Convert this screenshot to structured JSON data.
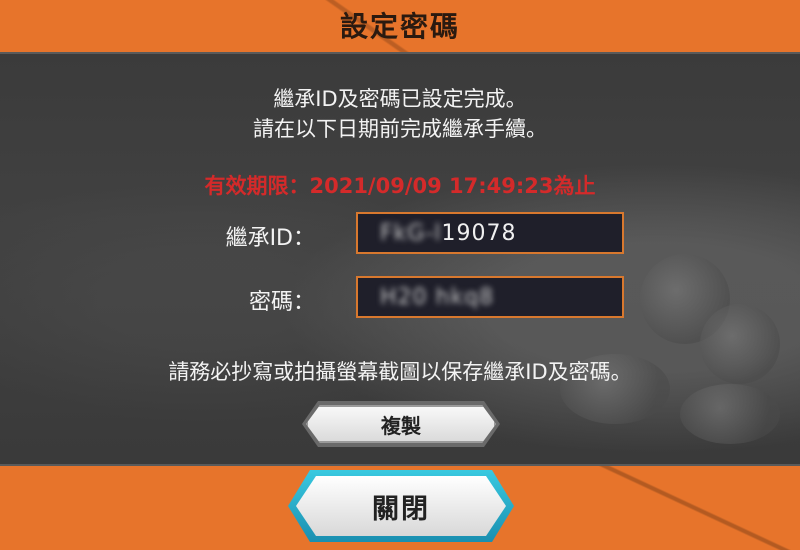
{
  "dialog": {
    "title": "設定密碼",
    "message_line1": "繼承ID及密碼已設定完成。",
    "message_line2": "請在以下日期前完成繼承手續。",
    "expiry": "有效期限：2021/09/09 17:49:23為止",
    "id_label": "繼承ID：",
    "id_value_visible": "19078",
    "id_value_blurred": "FkG‑l",
    "password_label": "密碼：",
    "password_value_blurred": "H20  hkq8",
    "note": "請務必抄寫或拍攝螢幕截圖以保存繼承ID及密碼。",
    "copy_button": "複製",
    "close_button": "關閉"
  },
  "colors": {
    "frame_orange": "#e7742b",
    "panel_dark": "#3b3b3b",
    "expiry_red": "#d42a2a",
    "field_border": "#d8782e",
    "close_button_accent": "#1a8fb0"
  }
}
